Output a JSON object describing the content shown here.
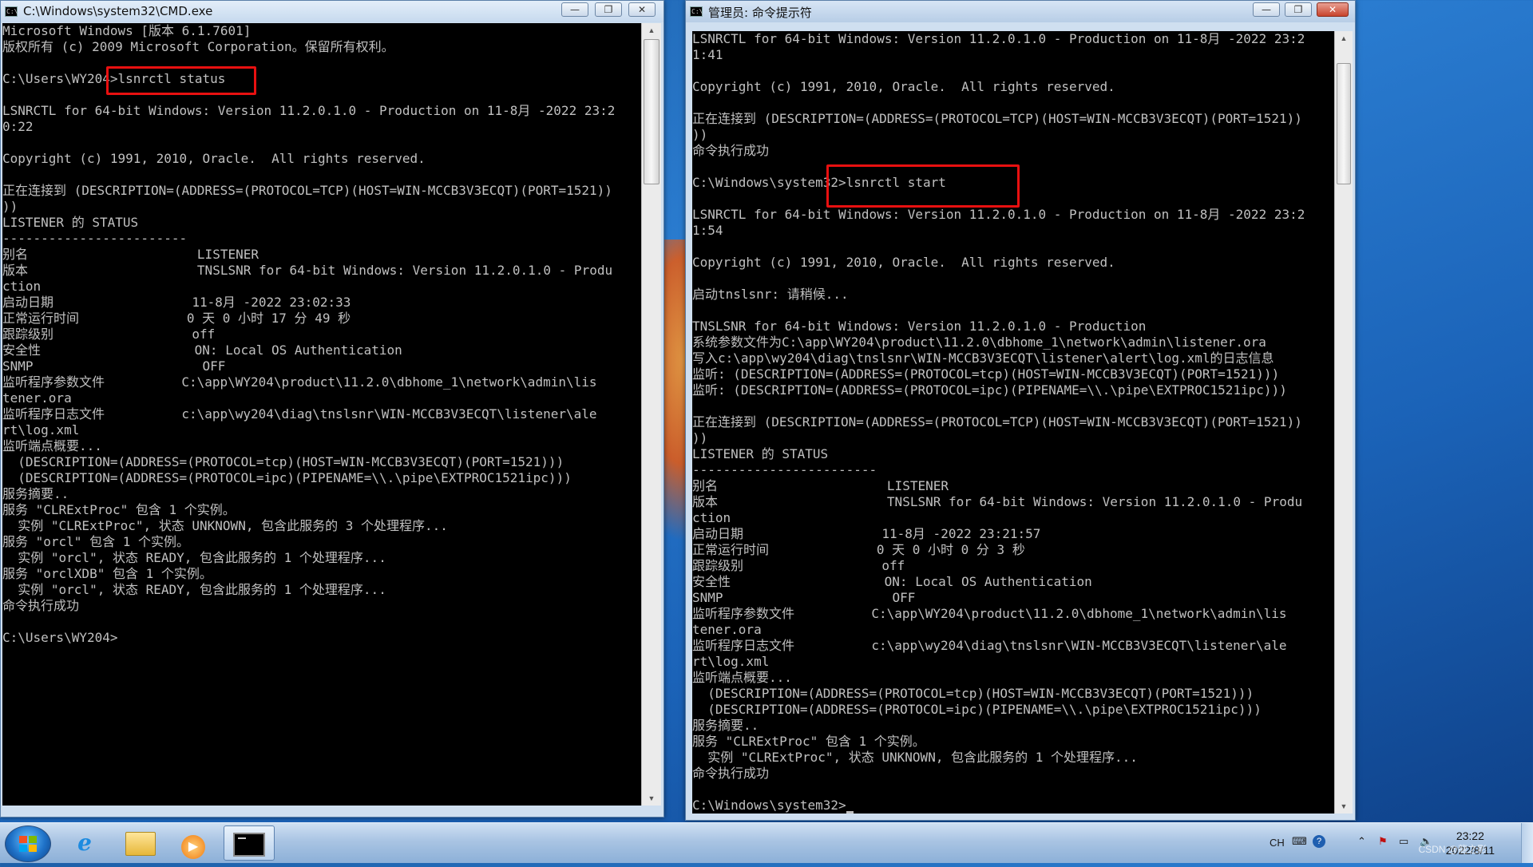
{
  "window1": {
    "title": "C:\\Windows\\system32\\CMD.exe",
    "buttons": {
      "minimize": "—",
      "maximize": "❐",
      "close": "✕"
    },
    "lines": [
      "Microsoft Windows [版本 6.1.7601]",
      "版权所有 (c) 2009 Microsoft Corporation。保留所有权利。",
      "",
      "C:\\Users\\WY204>lsnrctl status",
      "",
      "LSNRCTL for 64-bit Windows: Version 11.2.0.1.0 - Production on 11-8月 -2022 23:2",
      "0:22",
      "",
      "Copyright (c) 1991, 2010, Oracle.  All rights reserved.",
      "",
      "正在连接到 (DESCRIPTION=(ADDRESS=(PROTOCOL=TCP)(HOST=WIN-MCCB3V3ECQT)(PORT=1521))",
      "))",
      "LISTENER 的 STATUS",
      "------------------------",
      "别名                      LISTENER",
      "版本                      TNSLSNR for 64-bit Windows: Version 11.2.0.1.0 - Produ",
      "ction",
      "启动日期                  11-8月 -2022 23:02:33",
      "正常运行时间              0 天 0 小时 17 分 49 秒",
      "跟踪级别                  off",
      "安全性                    ON: Local OS Authentication",
      "SNMP                      OFF",
      "监听程序参数文件          C:\\app\\WY204\\product\\11.2.0\\dbhome_1\\network\\admin\\lis",
      "tener.ora",
      "监听程序日志文件          c:\\app\\wy204\\diag\\tnslsnr\\WIN-MCCB3V3ECQT\\listener\\ale",
      "rt\\log.xml",
      "监听端点概要...",
      "  (DESCRIPTION=(ADDRESS=(PROTOCOL=tcp)(HOST=WIN-MCCB3V3ECQT)(PORT=1521)))",
      "  (DESCRIPTION=(ADDRESS=(PROTOCOL=ipc)(PIPENAME=\\\\.\\pipe\\EXTPROC1521ipc)))",
      "服务摘要..",
      "服务 \"CLRExtProc\" 包含 1 个实例。",
      "  实例 \"CLRExtProc\", 状态 UNKNOWN, 包含此服务的 3 个处理程序...",
      "服务 \"orcl\" 包含 1 个实例。",
      "  实例 \"orcl\", 状态 READY, 包含此服务的 1 个处理程序...",
      "服务 \"orclXDB\" 包含 1 个实例。",
      "  实例 \"orcl\", 状态 READY, 包含此服务的 1 个处理程序...",
      "命令执行成功",
      "",
      "C:\\Users\\WY204>"
    ]
  },
  "window2": {
    "title": "管理员: 命令提示符",
    "buttons": {
      "minimize": "—",
      "maximize": "❐",
      "close": "✕"
    },
    "lines": [
      "LSNRCTL for 64-bit Windows: Version 11.2.0.1.0 - Production on 11-8月 -2022 23:2",
      "1:41",
      "",
      "Copyright (c) 1991, 2010, Oracle.  All rights reserved.",
      "",
      "正在连接到 (DESCRIPTION=(ADDRESS=(PROTOCOL=TCP)(HOST=WIN-MCCB3V3ECQT)(PORT=1521))",
      "))",
      "命令执行成功",
      "",
      "C:\\Windows\\system32>lsnrctl start",
      "",
      "LSNRCTL for 64-bit Windows: Version 11.2.0.1.0 - Production on 11-8月 -2022 23:2",
      "1:54",
      "",
      "Copyright (c) 1991, 2010, Oracle.  All rights reserved.",
      "",
      "启动tnslsnr: 请稍候...",
      "",
      "TNSLSNR for 64-bit Windows: Version 11.2.0.1.0 - Production",
      "系统参数文件为C:\\app\\WY204\\product\\11.2.0\\dbhome_1\\network\\admin\\listener.ora",
      "写入c:\\app\\wy204\\diag\\tnslsnr\\WIN-MCCB3V3ECQT\\listener\\alert\\log.xml的日志信息",
      "监听: (DESCRIPTION=(ADDRESS=(PROTOCOL=tcp)(HOST=WIN-MCCB3V3ECQT)(PORT=1521)))",
      "监听: (DESCRIPTION=(ADDRESS=(PROTOCOL=ipc)(PIPENAME=\\\\.\\pipe\\EXTPROC1521ipc)))",
      "",
      "正在连接到 (DESCRIPTION=(ADDRESS=(PROTOCOL=TCP)(HOST=WIN-MCCB3V3ECQT)(PORT=1521))",
      "))",
      "LISTENER 的 STATUS",
      "------------------------",
      "别名                      LISTENER",
      "版本                      TNSLSNR for 64-bit Windows: Version 11.2.0.1.0 - Produ",
      "ction",
      "启动日期                  11-8月 -2022 23:21:57",
      "正常运行时间              0 天 0 小时 0 分 3 秒",
      "跟踪级别                  off",
      "安全性                    ON: Local OS Authentication",
      "SNMP                      OFF",
      "监听程序参数文件          C:\\app\\WY204\\product\\11.2.0\\dbhome_1\\network\\admin\\lis",
      "tener.ora",
      "监听程序日志文件          c:\\app\\wy204\\diag\\tnslsnr\\WIN-MCCB3V3ECQT\\listener\\ale",
      "rt\\log.xml",
      "监听端点概要...",
      "  (DESCRIPTION=(ADDRESS=(PROTOCOL=tcp)(HOST=WIN-MCCB3V3ECQT)(PORT=1521)))",
      "  (DESCRIPTION=(ADDRESS=(PROTOCOL=ipc)(PIPENAME=\\\\.\\pipe\\EXTPROC1521ipc)))",
      "服务摘要..",
      "服务 \"CLRExtProc\" 包含 1 个实例。",
      "  实例 \"CLRExtProc\", 状态 UNKNOWN, 包含此服务的 1 个处理程序...",
      "命令执行成功",
      "",
      "C:\\Windows\\system32>"
    ]
  },
  "taskbar": {
    "ie_label": "e",
    "media_label": "▶",
    "tray_lang": "CH",
    "tray_keyboard": "⌨",
    "tray_help": "?",
    "tray_chevron": "⌃",
    "tray_flag": "⚑",
    "tray_network": "▭",
    "tray_volume": "🔈",
    "clock_time": "23:22",
    "clock_date": "2022/8/11",
    "watermark": "CSDN @龍之影"
  },
  "colors": {
    "console_bg": "#000000",
    "console_fg": "#c0c0c0",
    "highlight": "#e81010"
  }
}
